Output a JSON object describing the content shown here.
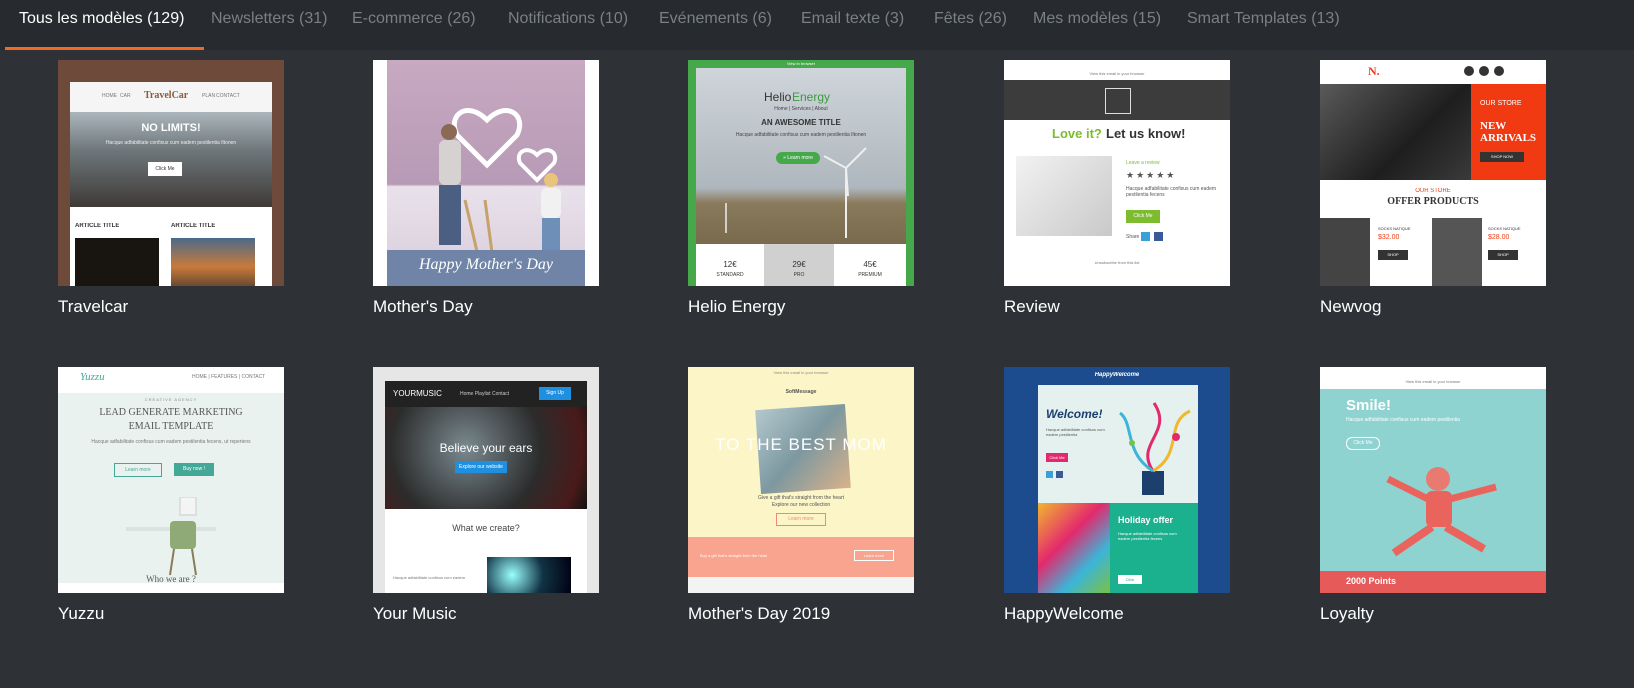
{
  "tabs": [
    {
      "label": "Tous les modèles (129)",
      "active": true
    },
    {
      "label": "Newsletters (31)"
    },
    {
      "label": "E-commerce (26)"
    },
    {
      "label": "Notifications (10)"
    },
    {
      "label": "Evénements (6)"
    },
    {
      "label": "Email texte (3)"
    },
    {
      "label": "Fêtes (26)"
    },
    {
      "label": "Mes modèles (15)"
    },
    {
      "label": "Smart Templates (13)"
    }
  ],
  "templates": [
    {
      "name": "Travelcar",
      "preview": {
        "brand": "TravelCar",
        "nav_left": [
          "HOME",
          "CAR"
        ],
        "nav_right": [
          "PLAN",
          "CONTACT"
        ],
        "headline": "NO LIMITS!",
        "body": "Hacque adfabilitate confisus cum eadem pestilentia Iltonen",
        "button": "Click Me",
        "article_1": "ARTICLE TITLE",
        "article_2": "ARTICLE TITLE"
      }
    },
    {
      "name": "Mother's Day",
      "preview": {
        "banner": "Happy Mother's Day"
      }
    },
    {
      "name": "Helio Energy",
      "preview": {
        "top_note": "View in browser",
        "brand_a": "Helio",
        "brand_b": "Energy",
        "nav": "Home | Services | About",
        "title": "AN AWESOME TITLE",
        "body": "Hacque adfabilitate confisus cum eadem pestilentia Iltonen",
        "button": "» Learn more",
        "prices": [
          "12€",
          "29€",
          "45€"
        ],
        "plans": [
          "STANDARD",
          "PRO",
          "PREMIUM"
        ]
      }
    },
    {
      "name": "Review",
      "preview": {
        "top_note": "View this email in your browser",
        "heading_a": "Love it?",
        "heading_b": "Let us know!",
        "review_label": "Leave a review",
        "stars": "★★★★★",
        "body": "Hacque adfabilitate confisus cum eadem pestilentia fecens",
        "button": "Click Me",
        "share": "Share",
        "footer": "Unsubscribe from this list"
      }
    },
    {
      "name": "Newvog",
      "preview": {
        "logo": "N.",
        "store_label": "OUR STORE",
        "arrivals_a": "NEW",
        "arrivals_b": "ARRIVALS",
        "shop_now": "SHOP NOW",
        "offer_label": "OUR STORE",
        "offer_title": "OFFER PRODUCTS",
        "item_1_name": "SOCKS NATIQUE",
        "item_1_price": "$32.00",
        "item_2_name": "SOCKS NATIQUE",
        "item_2_price": "$28.00",
        "shop": "SHOP"
      }
    },
    {
      "name": "Yuzzu",
      "preview": {
        "brand": "Yuzzu",
        "nav": "HOME | FEATURES | CONTACT",
        "agency": "CREATIVE AGENCY",
        "title_a": "LEAD GENERATE MARKETING",
        "title_b": "EMAIL TEMPLATE",
        "body": "Hacque adfabilitate confisus cum eadem pestilentia fecens, ut reperiens",
        "btn_1": "Learn more",
        "btn_2": "Buy now !",
        "footer_heading": "Who we are ?"
      }
    },
    {
      "name": "Your Music",
      "preview": {
        "brand": "YOURMUSIC",
        "nav": "Home  Playlist  Contact",
        "signup": "Sign Up",
        "headline": "Believe your ears",
        "button": "Explore our website",
        "section": "What we create?",
        "footer_text": "Hacque adfabilitate confisus cum eadem"
      }
    },
    {
      "name": "Mother's Day 2019",
      "preview": {
        "top_note": "View this email in your browser",
        "brand": "SoftMessage",
        "overlay": "TO THE BEST MOM",
        "body_a": "Give a gift that's straight from the heart",
        "body_b": "Explore our new collection",
        "button": "Learn more",
        "footer_text": "Buy a gift that's straight from the heart",
        "footer_button": "Learn more"
      }
    },
    {
      "name": "HappyWelcome",
      "preview": {
        "brand": "HappyWelcome",
        "title": "Welcome!",
        "body": "Hacque adfabilitate confisus cum eadem pestilentia",
        "button": "Click Me",
        "offer_title": "Holiday offer",
        "offer_body": "Hacque adfabilitate confisus cum eadem pestilentia fecens",
        "offer_button": "Click"
      }
    },
    {
      "name": "Loyalty",
      "preview": {
        "top_note": "View this email in your browser",
        "title": "Smile!",
        "body": "Hacque adfabilitate confisus cum eadem pestilentia",
        "button": "Click Me",
        "points": "2000 Points"
      }
    }
  ],
  "colors": {
    "accent": "#f26a21",
    "tab_inactive": "#7b8085",
    "background": "#2e3237"
  }
}
